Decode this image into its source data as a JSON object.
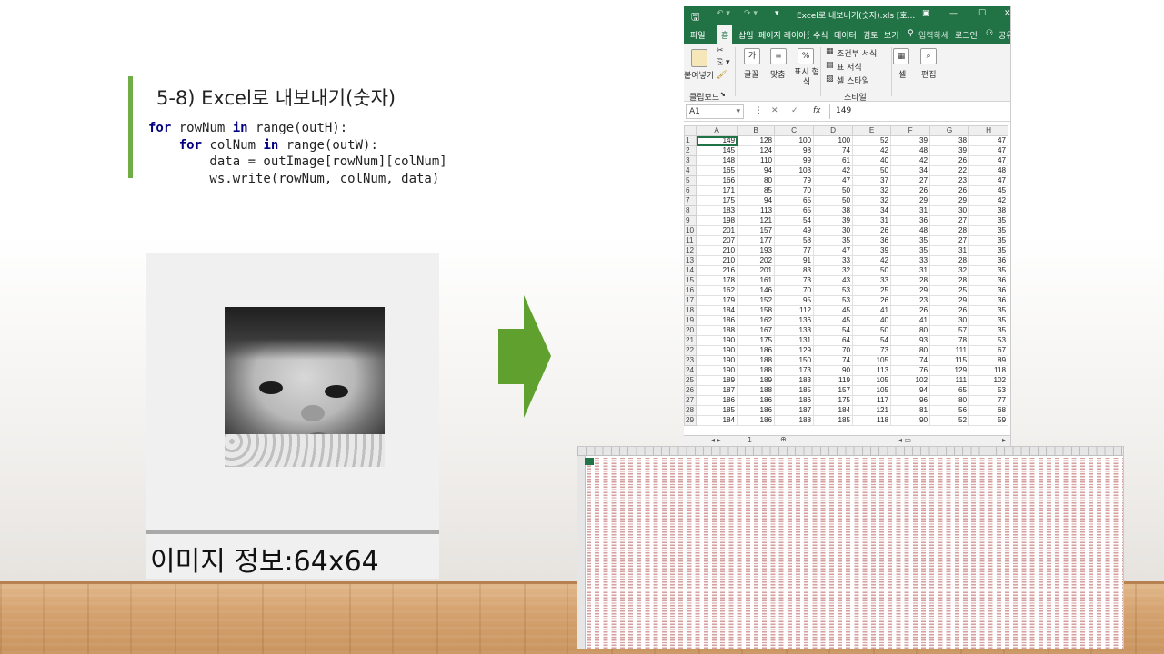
{
  "slide": {
    "title": "5-8) Excel로 내보내기(숫자)",
    "code_lines": [
      [
        "for",
        " rowNum ",
        "in",
        " range(outH):"
      ],
      [
        "    for",
        " colNum ",
        "in",
        " range(outW):"
      ],
      [
        "        data = outImage[rowNum][colNum]"
      ],
      [
        "        ws.write(rowNum, colNum, data)"
      ]
    ],
    "image_info": "이미지 정보:64x64",
    "accent_color": "#70ad47",
    "arrow_color": "#5fa02f"
  },
  "excel": {
    "title": "Excel로 내보내기(숫자).xls  [호...",
    "tabs": [
      "파일",
      "홈",
      "삽입",
      "페이지 레이아웃",
      "수식",
      "데이터",
      "검토",
      "보기"
    ],
    "active_tab": "홈",
    "tell_me": "입력하세",
    "login": "로그인",
    "share": "공유",
    "ribbon": {
      "paste": "붙여넣기",
      "clipboard": "클립보드",
      "font": "글꼴",
      "align": "맞춤",
      "number": "표시 형식",
      "cond_format": "조건부 서식",
      "table_format": "표 서식",
      "cell_style": "셀 스타일",
      "style_group": "스타일",
      "cells": "셀",
      "edit": "편집"
    },
    "name_box": "A1",
    "formula_value": "149",
    "columns": [
      "A",
      "B",
      "C",
      "D",
      "E",
      "F",
      "G",
      "H"
    ],
    "rows": [
      [
        1,
        149,
        128,
        100,
        100,
        52,
        39,
        38,
        47
      ],
      [
        2,
        145,
        124,
        98,
        74,
        42,
        48,
        39,
        47
      ],
      [
        3,
        148,
        110,
        99,
        61,
        40,
        42,
        26,
        47
      ],
      [
        4,
        165,
        94,
        103,
        42,
        50,
        34,
        22,
        48
      ],
      [
        5,
        166,
        80,
        79,
        47,
        37,
        27,
        23,
        47
      ],
      [
        6,
        171,
        85,
        70,
        50,
        32,
        26,
        26,
        45
      ],
      [
        7,
        175,
        94,
        65,
        50,
        32,
        29,
        29,
        42
      ],
      [
        8,
        183,
        113,
        65,
        38,
        34,
        31,
        30,
        38
      ],
      [
        9,
        198,
        121,
        54,
        39,
        31,
        36,
        27,
        35
      ],
      [
        10,
        201,
        157,
        49,
        30,
        26,
        48,
        28,
        35
      ],
      [
        11,
        207,
        177,
        58,
        35,
        36,
        35,
        27,
        35
      ],
      [
        12,
        210,
        193,
        77,
        47,
        39,
        35,
        31,
        35
      ],
      [
        13,
        210,
        202,
        91,
        33,
        42,
        33,
        28,
        36
      ],
      [
        14,
        216,
        201,
        83,
        32,
        50,
        31,
        32,
        35
      ],
      [
        15,
        178,
        161,
        73,
        43,
        33,
        28,
        28,
        36
      ],
      [
        16,
        162,
        146,
        70,
        53,
        25,
        29,
        25,
        36
      ],
      [
        17,
        179,
        152,
        95,
        53,
        26,
        23,
        29,
        36
      ],
      [
        18,
        184,
        158,
        112,
        45,
        41,
        26,
        26,
        35
      ],
      [
        19,
        186,
        162,
        136,
        45,
        40,
        41,
        30,
        35
      ],
      [
        20,
        188,
        167,
        133,
        54,
        50,
        80,
        57,
        35
      ],
      [
        21,
        190,
        175,
        131,
        64,
        54,
        93,
        78,
        53
      ],
      [
        22,
        190,
        186,
        129,
        70,
        73,
        80,
        111,
        67
      ],
      [
        23,
        190,
        188,
        150,
        74,
        105,
        74,
        115,
        89
      ],
      [
        24,
        190,
        188,
        173,
        90,
        113,
        76,
        129,
        118
      ],
      [
        25,
        189,
        189,
        183,
        119,
        105,
        102,
        111,
        102
      ],
      [
        26,
        187,
        188,
        185,
        157,
        105,
        94,
        65,
        53
      ],
      [
        27,
        186,
        186,
        186,
        175,
        117,
        96,
        80,
        77
      ],
      [
        28,
        185,
        186,
        187,
        184,
        121,
        81,
        56,
        68
      ],
      [
        29,
        184,
        186,
        188,
        185,
        118,
        90,
        52,
        59
      ]
    ],
    "sheet_tab": "1"
  }
}
